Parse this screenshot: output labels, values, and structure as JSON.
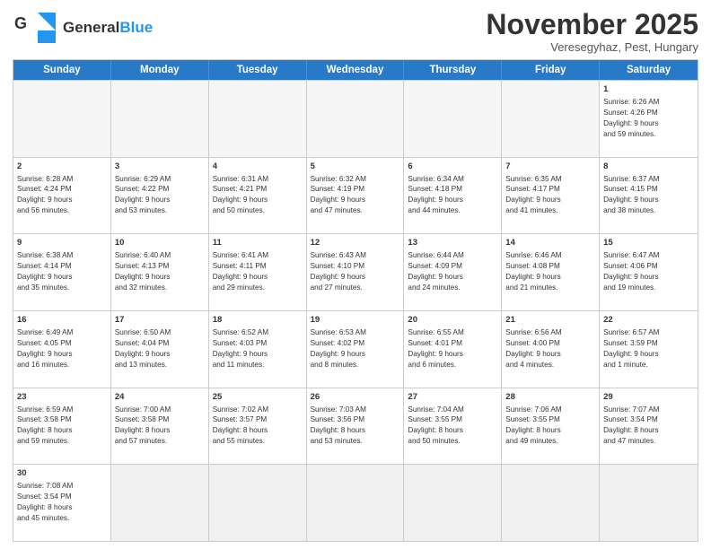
{
  "header": {
    "logo_text_black": "General",
    "logo_text_blue": "Blue",
    "month_title": "November 2025",
    "subtitle": "Veresegyhaz, Pest, Hungary"
  },
  "days_of_week": [
    "Sunday",
    "Monday",
    "Tuesday",
    "Wednesday",
    "Thursday",
    "Friday",
    "Saturday"
  ],
  "weeks": [
    [
      {
        "day": null,
        "data": null
      },
      {
        "day": null,
        "data": null
      },
      {
        "day": null,
        "data": null
      },
      {
        "day": null,
        "data": null
      },
      {
        "day": null,
        "data": null
      },
      {
        "day": null,
        "data": null
      },
      {
        "day": "1",
        "data": "Sunrise: 6:26 AM\nSunset: 4:26 PM\nDaylight: 9 hours\nand 59 minutes."
      }
    ],
    [
      {
        "day": "2",
        "data": "Sunrise: 6:28 AM\nSunset: 4:24 PM\nDaylight: 9 hours\nand 56 minutes."
      },
      {
        "day": "3",
        "data": "Sunrise: 6:29 AM\nSunset: 4:22 PM\nDaylight: 9 hours\nand 53 minutes."
      },
      {
        "day": "4",
        "data": "Sunrise: 6:31 AM\nSunset: 4:21 PM\nDaylight: 9 hours\nand 50 minutes."
      },
      {
        "day": "5",
        "data": "Sunrise: 6:32 AM\nSunset: 4:19 PM\nDaylight: 9 hours\nand 47 minutes."
      },
      {
        "day": "6",
        "data": "Sunrise: 6:34 AM\nSunset: 4:18 PM\nDaylight: 9 hours\nand 44 minutes."
      },
      {
        "day": "7",
        "data": "Sunrise: 6:35 AM\nSunset: 4:17 PM\nDaylight: 9 hours\nand 41 minutes."
      },
      {
        "day": "8",
        "data": "Sunrise: 6:37 AM\nSunset: 4:15 PM\nDaylight: 9 hours\nand 38 minutes."
      }
    ],
    [
      {
        "day": "9",
        "data": "Sunrise: 6:38 AM\nSunset: 4:14 PM\nDaylight: 9 hours\nand 35 minutes."
      },
      {
        "day": "10",
        "data": "Sunrise: 6:40 AM\nSunset: 4:13 PM\nDaylight: 9 hours\nand 32 minutes."
      },
      {
        "day": "11",
        "data": "Sunrise: 6:41 AM\nSunset: 4:11 PM\nDaylight: 9 hours\nand 29 minutes."
      },
      {
        "day": "12",
        "data": "Sunrise: 6:43 AM\nSunset: 4:10 PM\nDaylight: 9 hours\nand 27 minutes."
      },
      {
        "day": "13",
        "data": "Sunrise: 6:44 AM\nSunset: 4:09 PM\nDaylight: 9 hours\nand 24 minutes."
      },
      {
        "day": "14",
        "data": "Sunrise: 6:46 AM\nSunset: 4:08 PM\nDaylight: 9 hours\nand 21 minutes."
      },
      {
        "day": "15",
        "data": "Sunrise: 6:47 AM\nSunset: 4:06 PM\nDaylight: 9 hours\nand 19 minutes."
      }
    ],
    [
      {
        "day": "16",
        "data": "Sunrise: 6:49 AM\nSunset: 4:05 PM\nDaylight: 9 hours\nand 16 minutes."
      },
      {
        "day": "17",
        "data": "Sunrise: 6:50 AM\nSunset: 4:04 PM\nDaylight: 9 hours\nand 13 minutes."
      },
      {
        "day": "18",
        "data": "Sunrise: 6:52 AM\nSunset: 4:03 PM\nDaylight: 9 hours\nand 11 minutes."
      },
      {
        "day": "19",
        "data": "Sunrise: 6:53 AM\nSunset: 4:02 PM\nDaylight: 9 hours\nand 8 minutes."
      },
      {
        "day": "20",
        "data": "Sunrise: 6:55 AM\nSunset: 4:01 PM\nDaylight: 9 hours\nand 6 minutes."
      },
      {
        "day": "21",
        "data": "Sunrise: 6:56 AM\nSunset: 4:00 PM\nDaylight: 9 hours\nand 4 minutes."
      },
      {
        "day": "22",
        "data": "Sunrise: 6:57 AM\nSunset: 3:59 PM\nDaylight: 9 hours\nand 1 minute."
      }
    ],
    [
      {
        "day": "23",
        "data": "Sunrise: 6:59 AM\nSunset: 3:58 PM\nDaylight: 8 hours\nand 59 minutes."
      },
      {
        "day": "24",
        "data": "Sunrise: 7:00 AM\nSunset: 3:58 PM\nDaylight: 8 hours\nand 57 minutes."
      },
      {
        "day": "25",
        "data": "Sunrise: 7:02 AM\nSunset: 3:57 PM\nDaylight: 8 hours\nand 55 minutes."
      },
      {
        "day": "26",
        "data": "Sunrise: 7:03 AM\nSunset: 3:56 PM\nDaylight: 8 hours\nand 53 minutes."
      },
      {
        "day": "27",
        "data": "Sunrise: 7:04 AM\nSunset: 3:55 PM\nDaylight: 8 hours\nand 50 minutes."
      },
      {
        "day": "28",
        "data": "Sunrise: 7:06 AM\nSunset: 3:55 PM\nDaylight: 8 hours\nand 49 minutes."
      },
      {
        "day": "29",
        "data": "Sunrise: 7:07 AM\nSunset: 3:54 PM\nDaylight: 8 hours\nand 47 minutes."
      }
    ],
    [
      {
        "day": "30",
        "data": "Sunrise: 7:08 AM\nSunset: 3:54 PM\nDaylight: 8 hours\nand 45 minutes."
      },
      {
        "day": null,
        "data": null
      },
      {
        "day": null,
        "data": null
      },
      {
        "day": null,
        "data": null
      },
      {
        "day": null,
        "data": null
      },
      {
        "day": null,
        "data": null
      },
      {
        "day": null,
        "data": null
      }
    ]
  ]
}
